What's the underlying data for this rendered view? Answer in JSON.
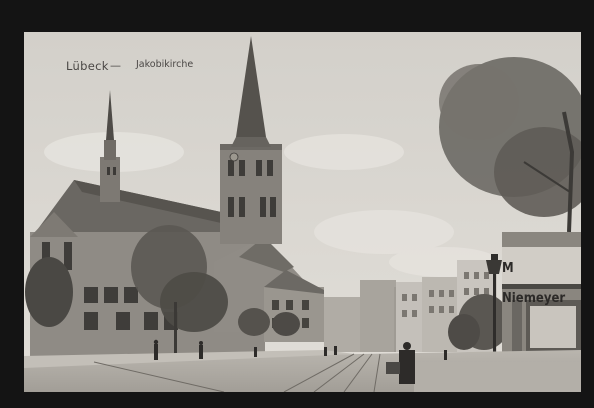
{
  "postcard": {
    "caption_city": "Lübeck",
    "caption_dash": "—",
    "caption_church": "Jakobikirche",
    "shop_sign": "M Niemeyer"
  },
  "colors": {
    "frame": "#141414",
    "sky": "#dad7d1",
    "stone": "#8d8983",
    "ink": "#2c2a28"
  }
}
